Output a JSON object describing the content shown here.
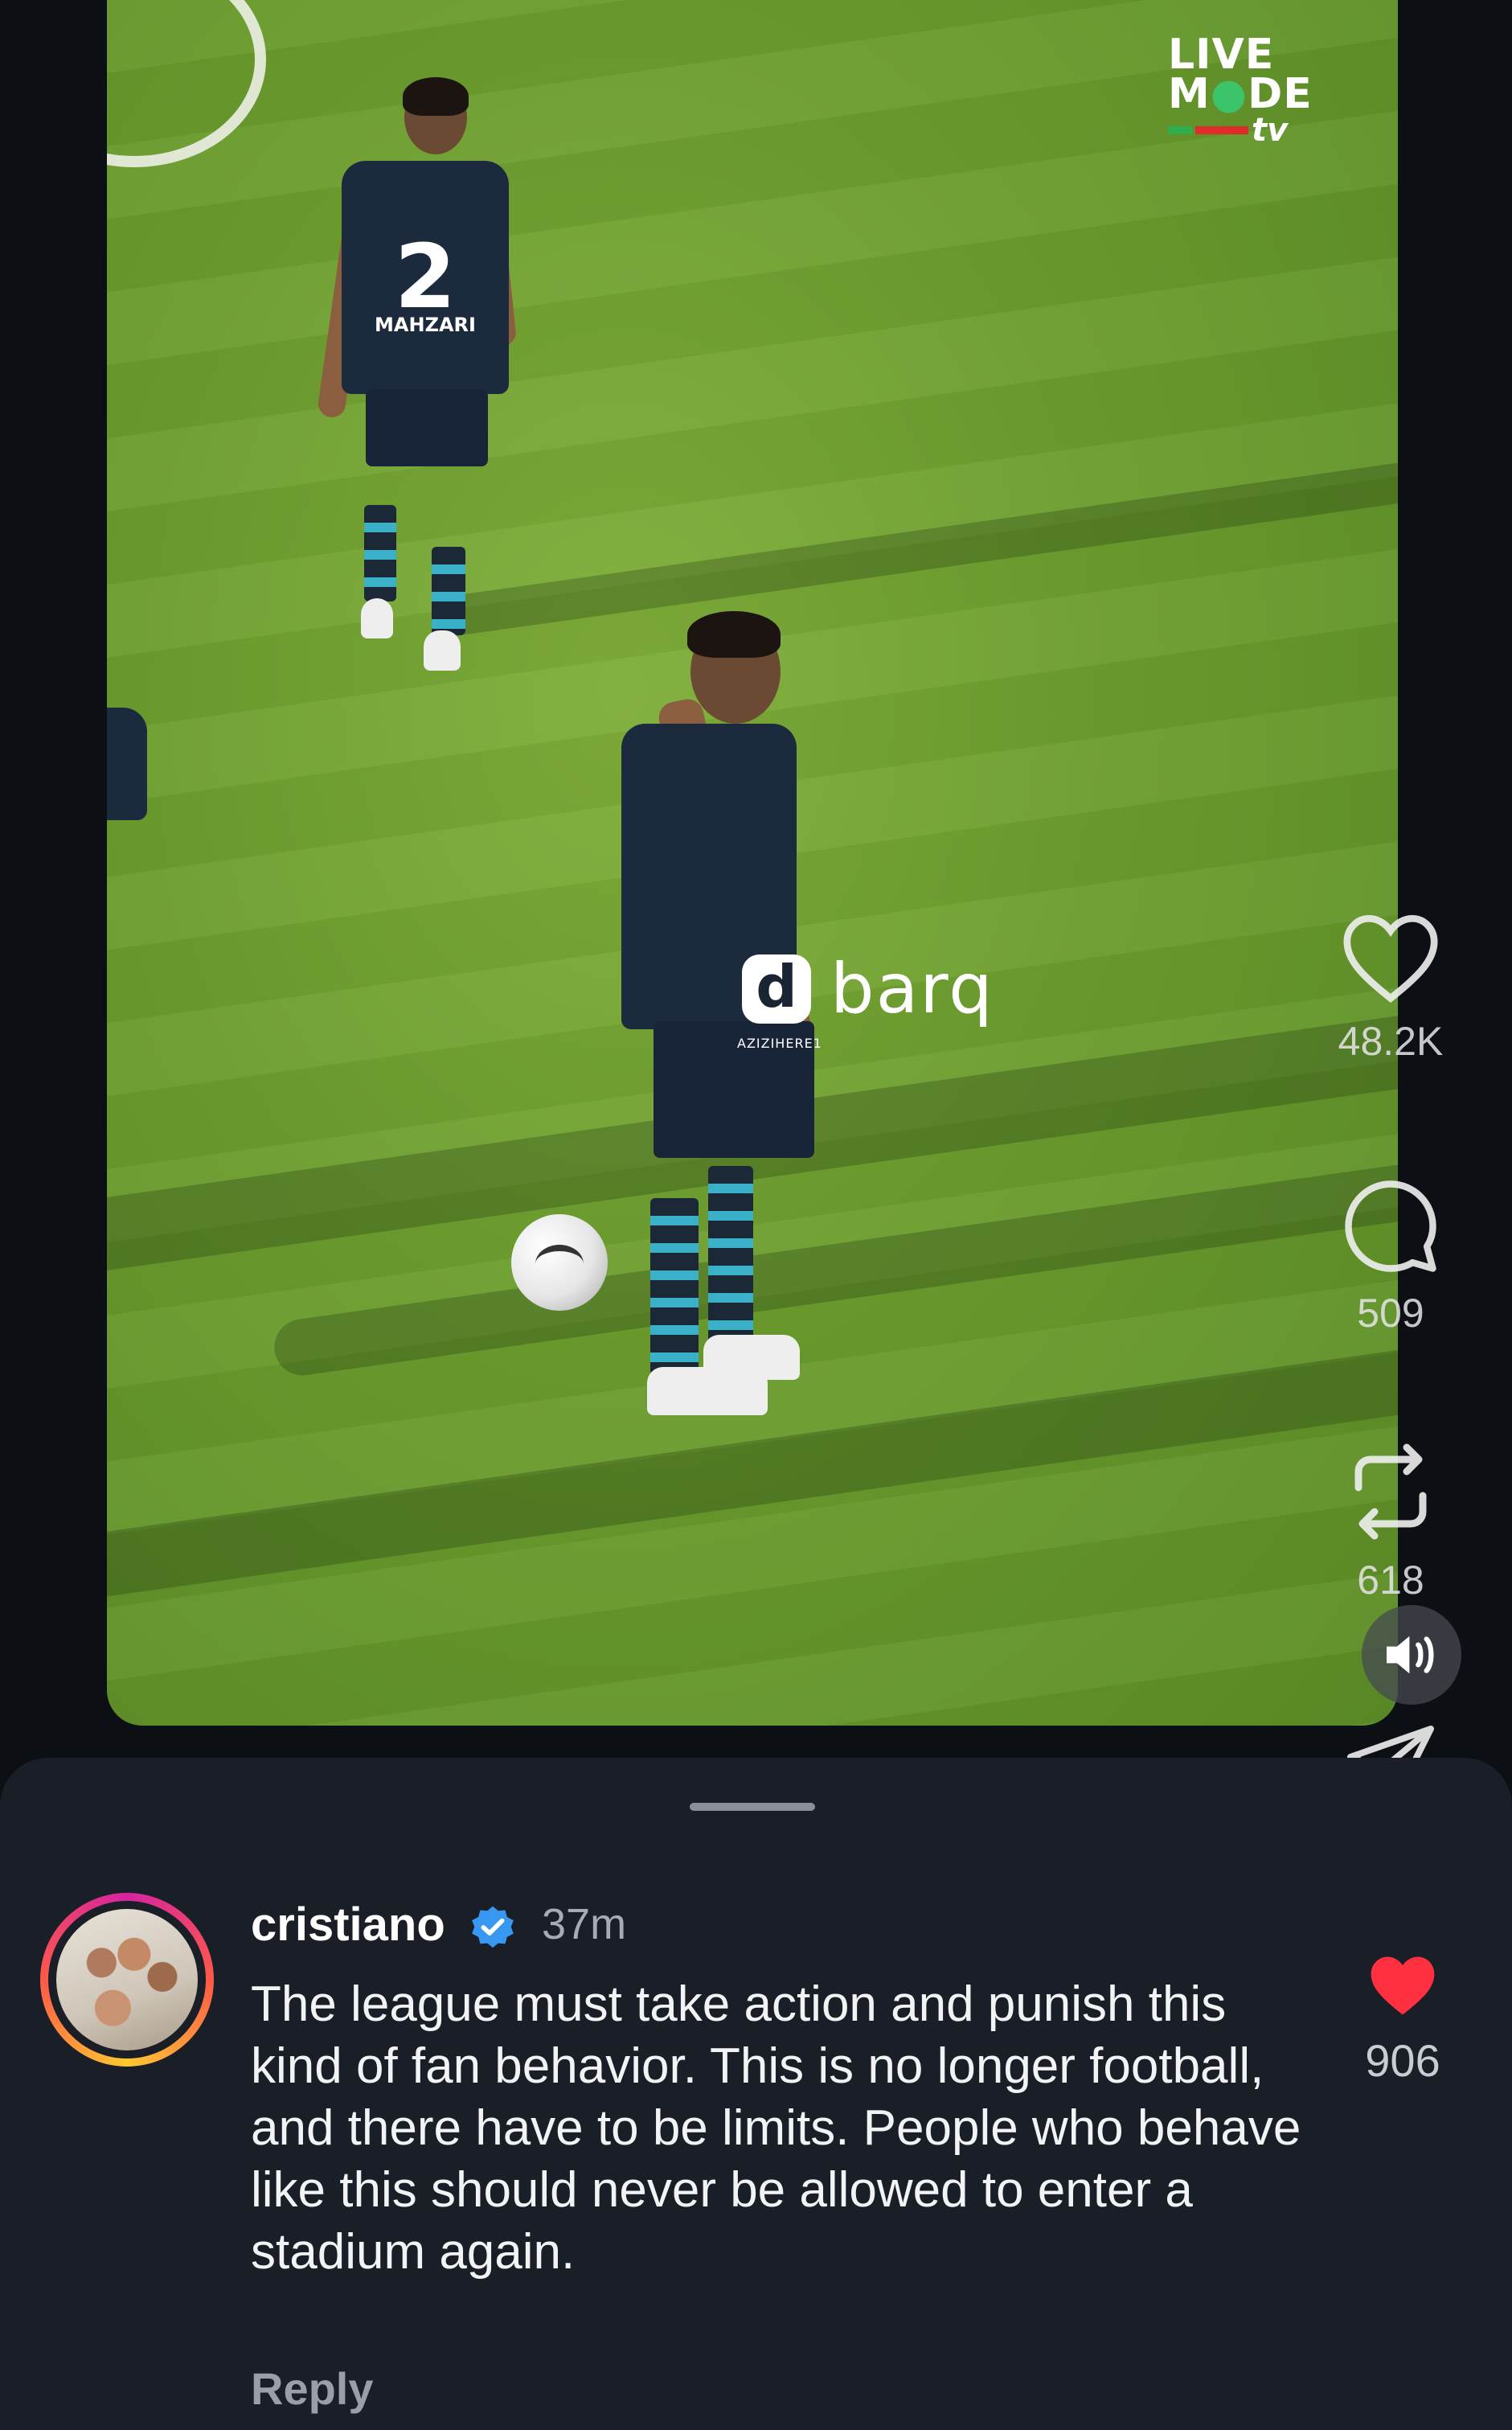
{
  "video": {
    "watermark_top_line1": "LIVE",
    "watermark_top_line2_a": "M",
    "watermark_top_line2_b": "DE",
    "watermark_top_suffix": "tv",
    "brand_logo_letter": "d",
    "brand_name": "barq",
    "brand_sub": "AZIZIHERE1",
    "player_number": "2",
    "player_name": "MAHZARI"
  },
  "actions": {
    "likes": "48.2K",
    "comments": "509",
    "reposts": "618",
    "icons": [
      "heart-outline-icon",
      "comment-bubble-icon",
      "repost-icon",
      "sound-on-icon",
      "share-icon"
    ]
  },
  "comment": {
    "username": "cristiano",
    "verified": true,
    "time": "37m",
    "text": "The league must take action and punish this kind of fan behavior. This is no longer football, and there have to be limits. People who behave like this should never be allowed to enter a stadium again.",
    "reply_label": "Reply",
    "like_count": "906"
  },
  "colors": {
    "background": "#0c0f14",
    "sheet": "#1a1e26",
    "verified_blue": "#3897f0",
    "like_red": "#ff3040"
  }
}
